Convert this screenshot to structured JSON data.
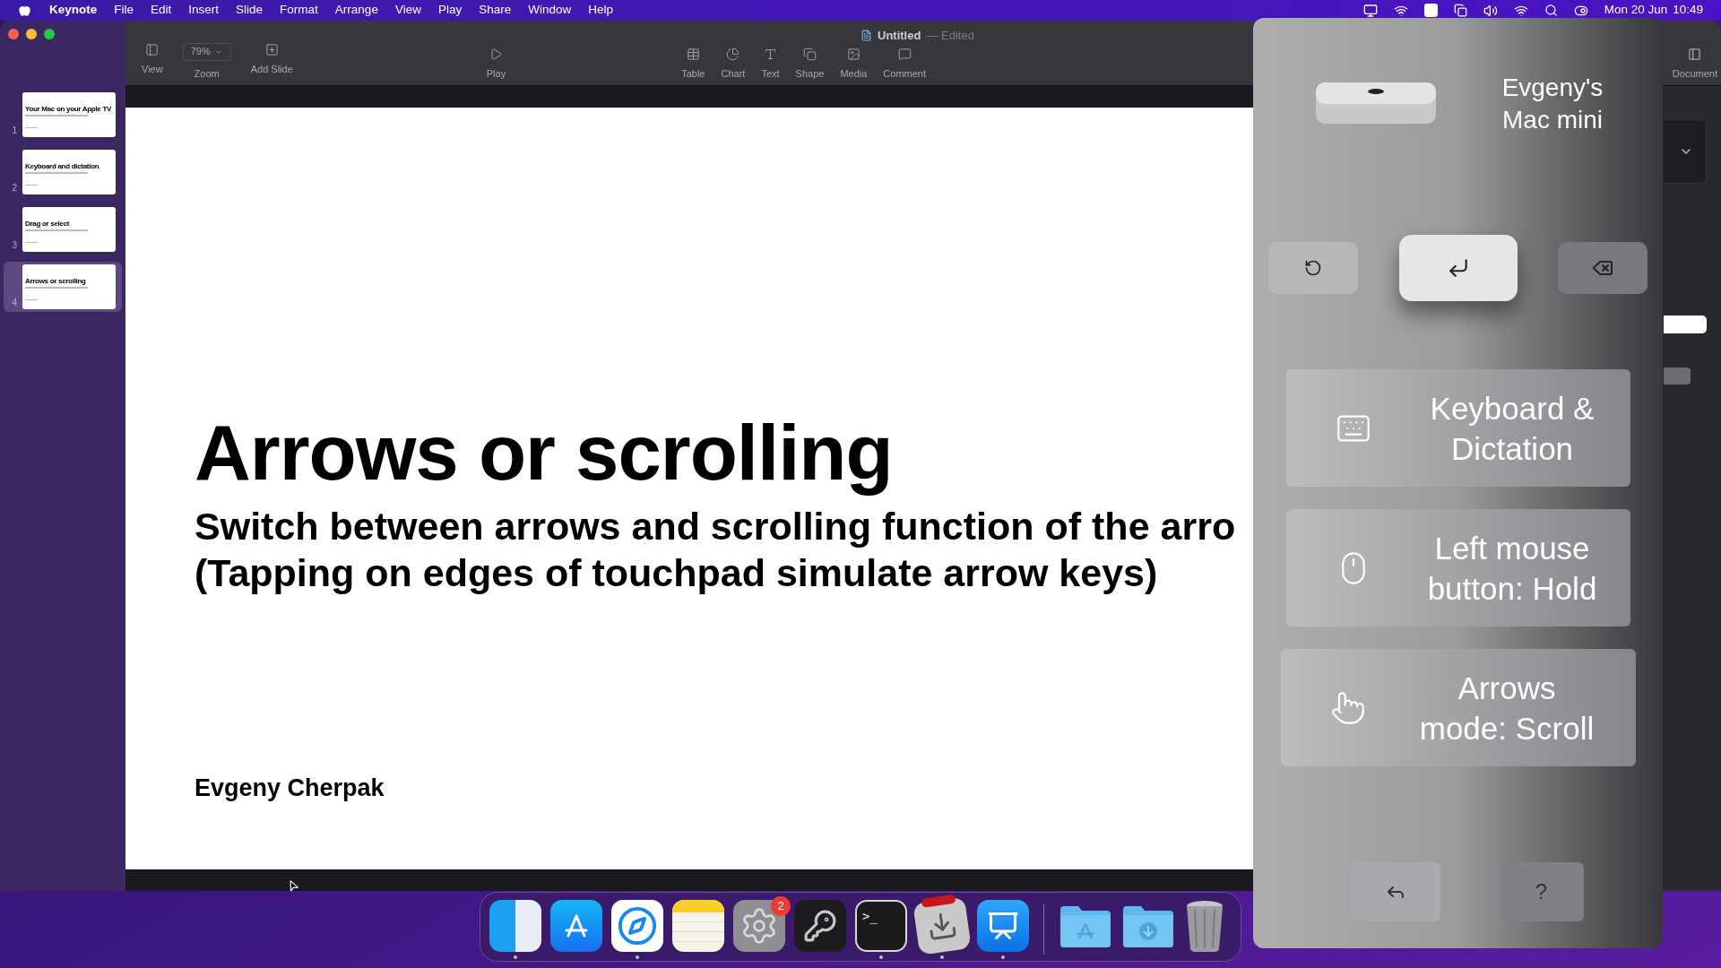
{
  "menu_bar": {
    "app": "Keynote",
    "items": [
      "File",
      "Edit",
      "Insert",
      "Slide",
      "Format",
      "Arrange",
      "View",
      "Play",
      "Share",
      "Window",
      "Help"
    ],
    "date": "Mon 20 Jun",
    "time": "10:49"
  },
  "window": {
    "title": "Untitled",
    "status": "— Edited"
  },
  "toolbar": {
    "left": [
      {
        "kind": "view",
        "label": "View"
      },
      {
        "kind": "zoom",
        "label": "Zoom",
        "value": "79%"
      },
      {
        "kind": "add",
        "label": "Add Slide"
      }
    ],
    "center": [
      {
        "kind": "play",
        "label": "Play"
      }
    ],
    "right": [
      {
        "kind": "table",
        "label": "Table"
      },
      {
        "kind": "chart",
        "label": "Chart"
      },
      {
        "kind": "text",
        "label": "Text"
      },
      {
        "kind": "shape",
        "label": "Shape"
      },
      {
        "kind": "media",
        "label": "Media"
      },
      {
        "kind": "comment",
        "label": "Comment"
      }
    ],
    "inspector": {
      "label": "Document"
    }
  },
  "slides": [
    {
      "number": "1",
      "title": "Your Mac on your Apple TV",
      "selected": false
    },
    {
      "number": "2",
      "title": "Keyboard and dictation",
      "selected": false
    },
    {
      "number": "3",
      "title": "Drag or select",
      "selected": false
    },
    {
      "number": "4",
      "title": "Arrows or scrolling",
      "selected": true
    }
  ],
  "slide": {
    "title": "Arrows or scrolling",
    "subtitle_lines": [
      "Switch between arrows and scrolling function of the arro",
      "(Tapping on edges of touchpad simulate arrow keys)"
    ],
    "author": "Evgeny Cherpak"
  },
  "remote": {
    "device": "Evgeny's Mac mini",
    "keys": [
      {
        "kind": "refresh",
        "focused": false
      },
      {
        "kind": "return",
        "focused": true
      },
      {
        "kind": "delete",
        "focused": false
      }
    ],
    "modes": [
      {
        "kind": "keyboard",
        "label": "Keyboard & Dictation"
      },
      {
        "kind": "mouse",
        "label": "Left mouse button: Hold"
      },
      {
        "kind": "hand",
        "label": "Arrows mode: Scroll"
      }
    ],
    "bottom": [
      {
        "kind": "back"
      },
      {
        "kind": "help",
        "label": "?"
      }
    ]
  },
  "dock": [
    {
      "kind": "finder",
      "running": true
    },
    {
      "kind": "store",
      "running": false
    },
    {
      "kind": "compass",
      "running": true
    },
    {
      "kind": "notes",
      "running": false
    },
    {
      "kind": "gear",
      "running": false,
      "badge": "2"
    },
    {
      "kind": "keys",
      "running": false
    },
    {
      "kind": "terminal",
      "running": true,
      "text": ">_"
    },
    {
      "kind": "transfer",
      "running": true
    },
    {
      "kind": "podium",
      "running": true
    },
    {
      "kind": "divider"
    },
    {
      "kind": "folder-store",
      "running": false
    },
    {
      "kind": "folder-down",
      "running": false
    },
    {
      "kind": "trash",
      "running": false
    }
  ]
}
